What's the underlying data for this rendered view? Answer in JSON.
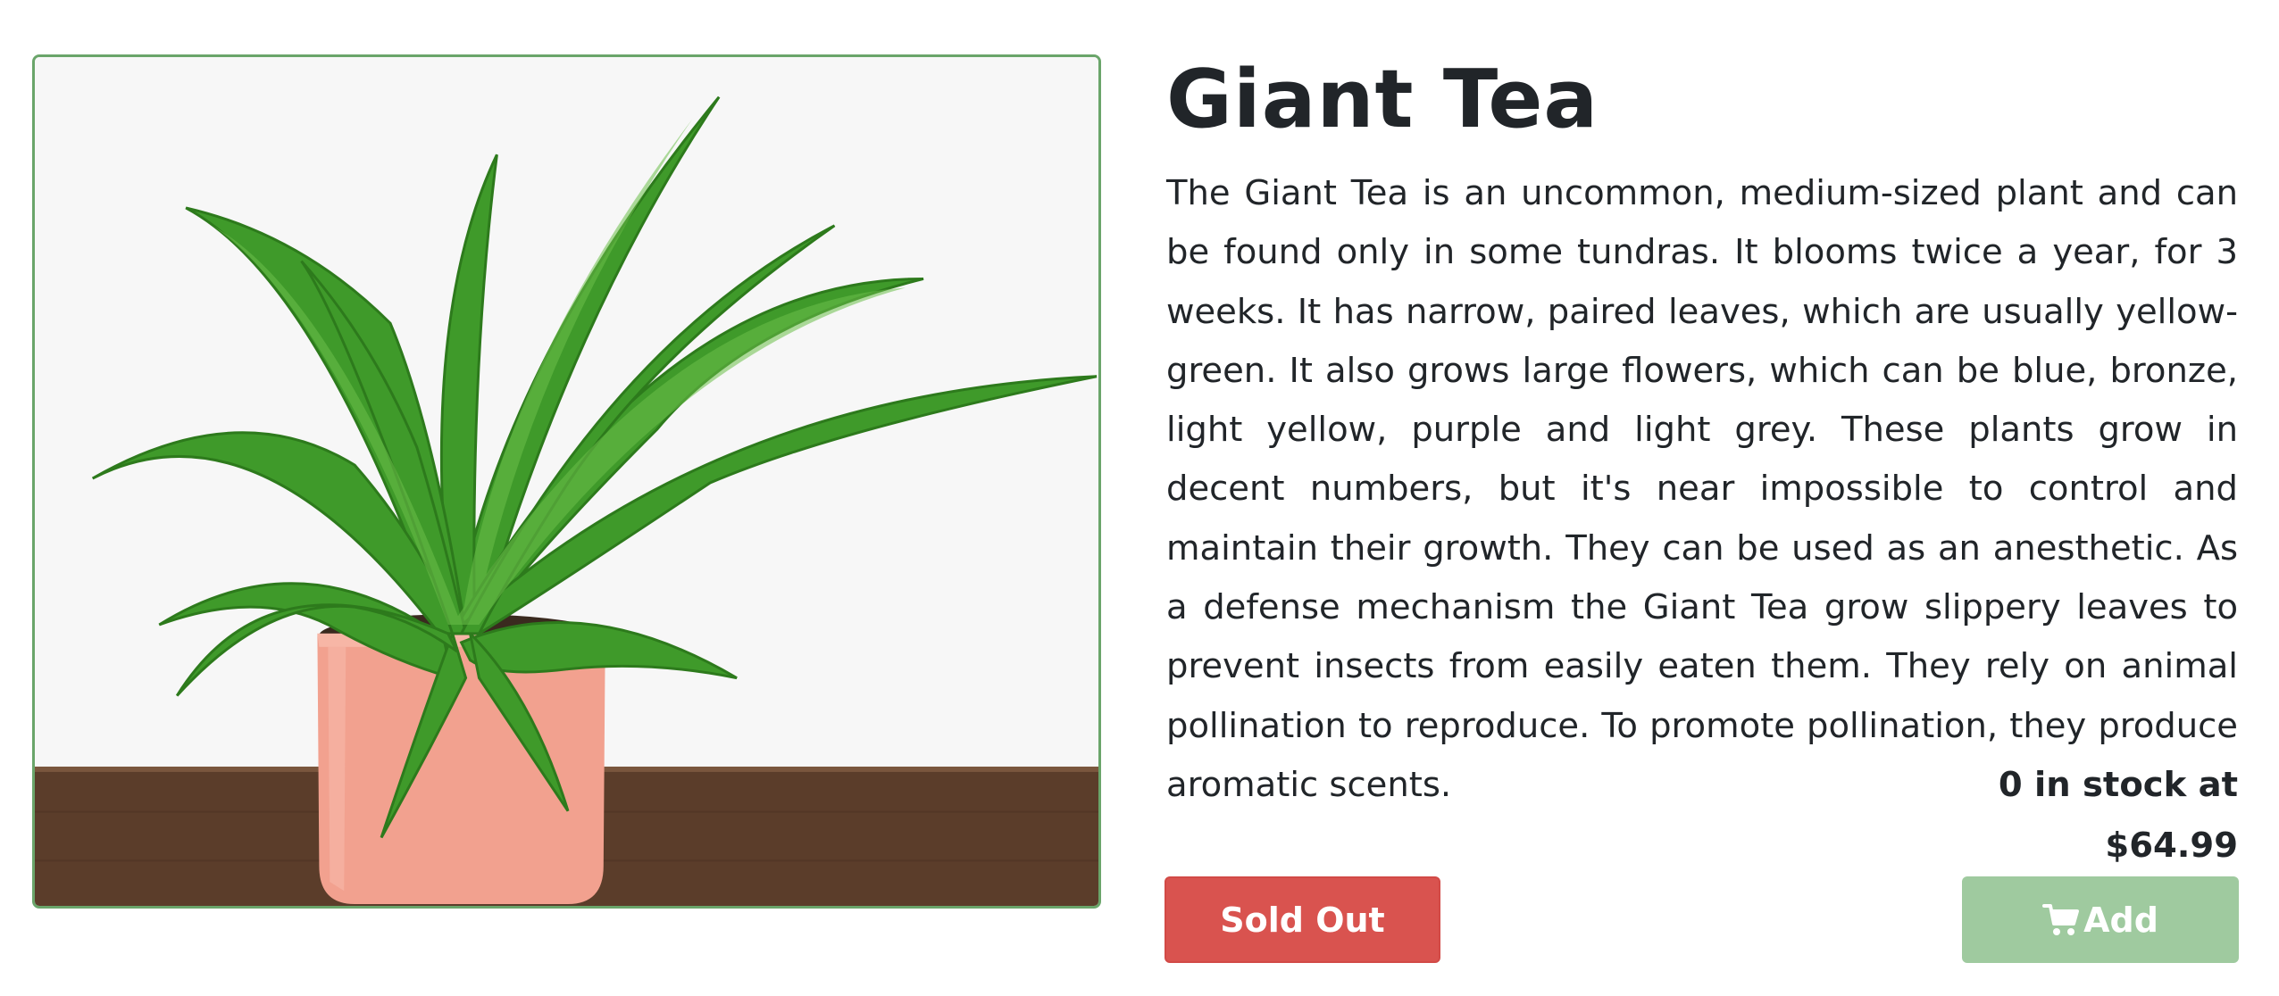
{
  "product": {
    "name": "Giant Tea",
    "description": "The Giant Tea is an uncommon, medium-sized plant and can be found only in some tundras. It blooms twice a year, for 3 weeks. It has narrow, paired leaves, which are usually yellow-green. It also grows large flowers, which can be blue, bronze, light yellow, purple and light grey. These plants grow in decent numbers, but it's near impossible to control and maintain their growth. They can be used as an anesthetic. As a defense mechanism the Giant Tea grow slippery leaves to prevent insects from easily eaten them. They rely on animal pollination to reproduce. To promote pollination, they produce aromatic scents.",
    "stock_text": "0 in stock at",
    "price": "$64.99",
    "image_alt": "potted fern plant photo"
  },
  "actions": {
    "sold_out_label": "Sold Out",
    "add_label": "Add",
    "add_icon": "cart-icon"
  },
  "colors": {
    "sold_out": "#d9534f",
    "add_disabled": "#9fca9f",
    "image_border": "#6aa56a",
    "text": "#212529"
  }
}
